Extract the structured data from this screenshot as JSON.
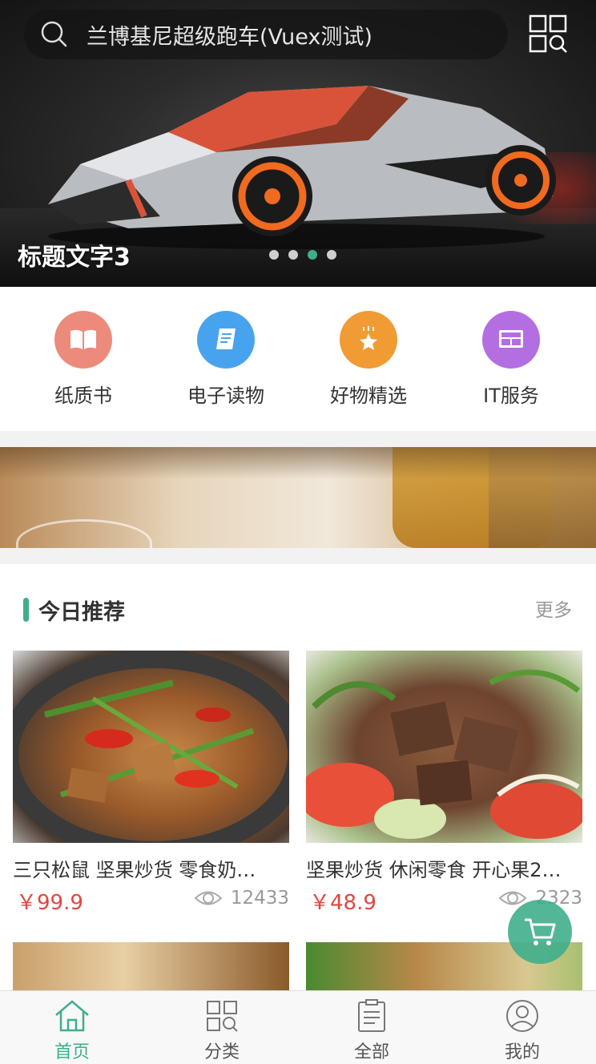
{
  "search": {
    "placeholder": "兰博基尼超级跑车(Vuex测试)"
  },
  "banner": {
    "title": "标题文字3",
    "slide_count": 4,
    "active_slide": 3
  },
  "categories": [
    {
      "label": "纸质书",
      "icon": "book-icon",
      "color": "#ec8a7b"
    },
    {
      "label": "电子读物",
      "icon": "ebook-icon",
      "color": "#48a3ef"
    },
    {
      "label": "好物精选",
      "icon": "star-gift-icon",
      "color": "#f09b33"
    },
    {
      "label": "IT服务",
      "icon": "monitor-icon",
      "color": "#b36fe2"
    }
  ],
  "recommend": {
    "title": "今日推荐",
    "more": "更多",
    "items": [
      {
        "name": "三只松鼠 坚果炒货 零食奶…",
        "price": "￥99.9",
        "views": "12433"
      },
      {
        "name": "坚果炒货 休闲零食 开心果2…",
        "price": "￥48.9",
        "views": "2323"
      }
    ]
  },
  "tabbar": [
    {
      "label": "首页",
      "icon": "home-icon",
      "active": true
    },
    {
      "label": "分类",
      "icon": "category-icon",
      "active": false
    },
    {
      "label": "全部",
      "icon": "list-icon",
      "active": false
    },
    {
      "label": "我的",
      "icon": "user-icon",
      "active": false
    }
  ],
  "colors": {
    "accent": "#3fae8c",
    "price": "#e2463f"
  }
}
